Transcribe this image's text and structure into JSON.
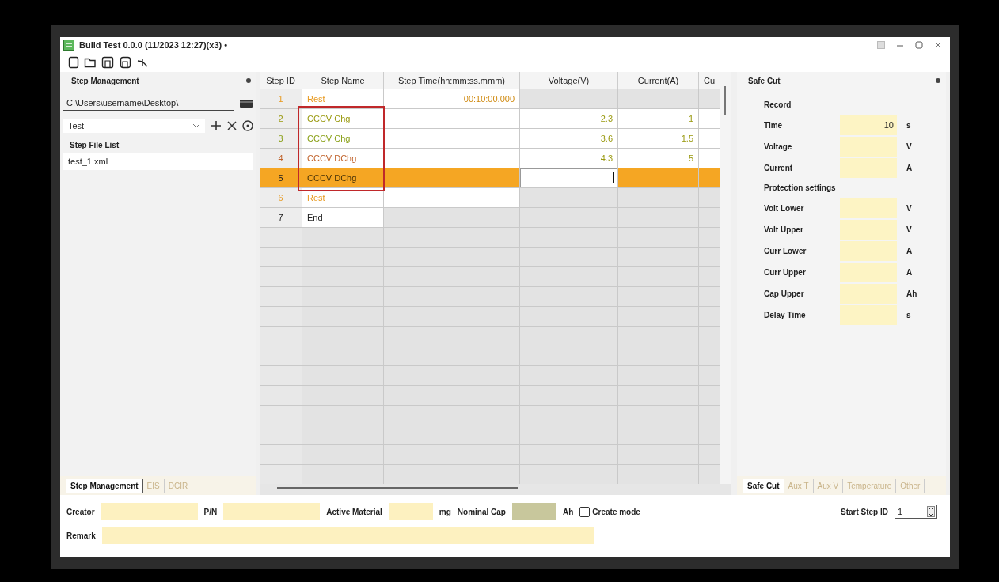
{
  "window": {
    "title": "Build Test 0.0.0 (11/2023 12:27)(x3) •"
  },
  "left_panel": {
    "title": "Step Management",
    "path": "C:\\Users\\username\\Desktop\\",
    "profile": "Test",
    "list_title": "Step File List",
    "files": [
      {
        "name": "test_1.xml",
        "selected": false
      }
    ],
    "tabs": [
      {
        "label": "Step Management",
        "selected": true
      },
      {
        "label": "EIS",
        "selected": false
      },
      {
        "label": "DCIR",
        "selected": false
      }
    ]
  },
  "table": {
    "columns": [
      "Step ID",
      "Step Name",
      "Step Time(hh:mm:ss.mmm)",
      "Voltage(V)",
      "Current(A)",
      "Cu"
    ],
    "rows": [
      {
        "color": "#e89a20",
        "selected": false,
        "highlighted": false,
        "cells": [
          {
            "text": "1",
            "enabled": false,
            "editing": false
          },
          {
            "text": "Rest",
            "enabled": true,
            "editing": false
          },
          {
            "text": "00:10:00.000",
            "enabled": true,
            "editing": false
          },
          {
            "text": "",
            "enabled": false,
            "editing": false
          },
          {
            "text": "",
            "enabled": false,
            "editing": false
          },
          {
            "text": "",
            "enabled": false,
            "editing": false
          }
        ]
      },
      {
        "color": "#9a9a10",
        "selected": false,
        "highlighted": true,
        "cells": [
          {
            "text": "2",
            "enabled": false,
            "editing": false
          },
          {
            "text": "CCCV Chg",
            "enabled": true,
            "editing": false
          },
          {
            "text": "",
            "enabled": true,
            "editing": false
          },
          {
            "text": "2.3",
            "enabled": true,
            "editing": false
          },
          {
            "text": "1",
            "enabled": true,
            "editing": false
          },
          {
            "text": "",
            "enabled": true,
            "editing": false
          }
        ]
      },
      {
        "color": "#8aa018",
        "selected": false,
        "highlighted": true,
        "cells": [
          {
            "text": "3",
            "enabled": false,
            "editing": false
          },
          {
            "text": "CCCV Chg",
            "enabled": true,
            "editing": false
          },
          {
            "text": "",
            "enabled": true,
            "editing": false
          },
          {
            "text": "3.6",
            "enabled": true,
            "editing": false
          },
          {
            "text": "1.5",
            "enabled": true,
            "editing": false
          },
          {
            "text": "",
            "enabled": true,
            "editing": false
          }
        ]
      },
      {
        "color": "#c0622a",
        "selected": false,
        "highlighted": true,
        "cells": [
          {
            "text": "4",
            "enabled": false,
            "editing": false
          },
          {
            "text": "CCCV DChg",
            "enabled": true,
            "editing": false
          },
          {
            "text": "",
            "enabled": true,
            "editing": false
          },
          {
            "text": "4.3",
            "enabled": true,
            "editing": false
          },
          {
            "text": "5",
            "enabled": true,
            "editing": false
          },
          {
            "text": "",
            "enabled": true,
            "editing": false
          }
        ]
      },
      {
        "selected": true,
        "highlighted": true,
        "cells": [
          {
            "text": "5",
            "enabled": false,
            "editing": false
          },
          {
            "text": "CCCV DChg",
            "enabled": true,
            "editing": false
          },
          {
            "text": "",
            "enabled": true,
            "editing": false
          },
          {
            "text": "",
            "enabled": true,
            "editing": true
          },
          {
            "text": "",
            "enabled": true,
            "editing": false
          },
          {
            "text": "",
            "enabled": true,
            "editing": false
          }
        ]
      },
      {
        "color": "#e89a20",
        "selected": false,
        "highlighted": false,
        "cells": [
          {
            "text": "6",
            "enabled": false,
            "editing": false
          },
          {
            "text": "Rest",
            "enabled": true,
            "editing": false
          },
          {
            "text": "",
            "enabled": true,
            "editing": false
          },
          {
            "text": "",
            "enabled": false,
            "editing": false
          },
          {
            "text": "",
            "enabled": false,
            "editing": false
          },
          {
            "text": "",
            "enabled": false,
            "editing": false
          }
        ]
      },
      {
        "color": "#222222",
        "selected": false,
        "highlighted": false,
        "cells": [
          {
            "text": "7",
            "enabled": false,
            "editing": false
          },
          {
            "text": "End",
            "enabled": true,
            "editing": false
          },
          {
            "text": "",
            "enabled": false,
            "editing": false
          },
          {
            "text": "",
            "enabled": false,
            "editing": false
          },
          {
            "text": "",
            "enabled": false,
            "editing": false
          },
          {
            "text": "",
            "enabled": false,
            "editing": false
          }
        ]
      }
    ]
  },
  "right_panel": {
    "title": "Safe Cut",
    "items": [
      {
        "kind": "heading",
        "label": "Record"
      },
      {
        "kind": "field",
        "label": "Time",
        "value": "10",
        "unit": "s"
      },
      {
        "kind": "field",
        "label": "Voltage",
        "unit": "V"
      },
      {
        "kind": "field",
        "label": "Current",
        "unit": "A"
      },
      {
        "kind": "heading",
        "label": "Protection settings"
      },
      {
        "kind": "field",
        "label": "Volt Lower",
        "unit": "V"
      },
      {
        "kind": "field",
        "label": "Volt Upper",
        "unit": "V"
      },
      {
        "kind": "field",
        "label": "Curr Lower",
        "unit": "A"
      },
      {
        "kind": "field",
        "label": "Curr Upper",
        "unit": "A"
      },
      {
        "kind": "field",
        "label": "Cap Upper",
        "unit": "Ah"
      },
      {
        "kind": "field",
        "label": "Delay Time",
        "unit": "s"
      }
    ],
    "tabs": [
      {
        "label": "Safe Cut",
        "selected": true
      },
      {
        "label": "Aux T",
        "selected": false
      },
      {
        "label": "Aux V",
        "selected": false
      },
      {
        "label": "Temperature",
        "selected": false
      },
      {
        "label": "Other",
        "selected": false
      }
    ]
  },
  "form": {
    "creator_label": "Creator",
    "pn_label": "P/N",
    "material_label": "Active Material",
    "material_unit": "mg",
    "capacity_label": "Nominal Cap",
    "capacity_unit": "Ah",
    "capacity_disabled": true,
    "create_mode": {
      "label": "Create mode",
      "checked": false
    },
    "start_step": {
      "label": "Start Step ID",
      "value": "1"
    },
    "remark_label": "Remark"
  }
}
